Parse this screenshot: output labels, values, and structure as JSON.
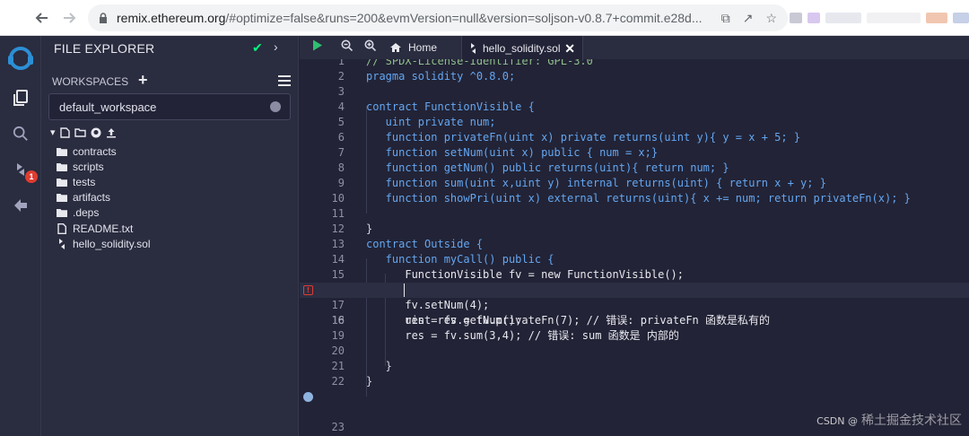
{
  "browser": {
    "url_host": "remix.ethereum.org",
    "url_path": "/#optimize=false&runs=200&evmVersion=null&version=soljson-v0.8.7+commit.e28d..."
  },
  "icon_panel": {
    "badge_count": "1"
  },
  "side_panel": {
    "title": "FILE EXPLORER",
    "workspaces_label": "WORKSPACES",
    "workspace_selected": "default_workspace",
    "files": [
      {
        "name": "contracts",
        "type": "folder"
      },
      {
        "name": "scripts",
        "type": "folder"
      },
      {
        "name": "tests",
        "type": "folder"
      },
      {
        "name": "artifacts",
        "type": "folder"
      },
      {
        "name": ".deps",
        "type": "folder"
      },
      {
        "name": "README.txt",
        "type": "file"
      },
      {
        "name": "hello_solidity.sol",
        "type": "solidity"
      }
    ]
  },
  "tabs": {
    "home_label": "Home",
    "file_label": "hello_solidity.sol"
  },
  "code": {
    "lines": [
      {
        "n": "1",
        "text": "// SPDX-License-Identifier: GPL-3.0"
      },
      {
        "n": "2",
        "text": "pragma solidity ^0.8.0;"
      },
      {
        "n": "3",
        "text": ""
      },
      {
        "n": "4",
        "text": "contract FunctionVisible {"
      },
      {
        "n": "5",
        "text": "   uint private num;"
      },
      {
        "n": "6",
        "text": "   function privateFn(uint x) private returns(uint y){ y = x + 5; }"
      },
      {
        "n": "7",
        "text": "   function setNum(uint x) public { num = x;}"
      },
      {
        "n": "8",
        "text": "   function getNum() public returns(uint){ return num; }"
      },
      {
        "n": "9",
        "text": "   function sum(uint x,uint y) internal returns(uint) { return x + y; }"
      },
      {
        "n": "10",
        "text": "   function showPri(uint x) external returns(uint){ x += num; return privateFn(x); }"
      },
      {
        "n": "11",
        "text": ""
      },
      {
        "n": "12",
        "text": "}"
      },
      {
        "n": "13",
        "text": "contract Outside {"
      },
      {
        "n": "14",
        "text": "   function myCall() public {"
      },
      {
        "n": "15",
        "text": "      FunctionVisible fv = new FunctionVisible();"
      },
      {
        "n": "16",
        "text": "      uint res = fv.privateFn(7); // 错误: privateFn 函数是私有的"
      },
      {
        "n": "17",
        "text": "      fv.setNum(4);"
      },
      {
        "n": "18",
        "text": "      res = fv.getNum();"
      },
      {
        "n": "19",
        "text": "      res = fv.sum(3,4); // 错误: sum 函数是 内部的"
      },
      {
        "n": "20",
        "text": ""
      },
      {
        "n": "21",
        "text": "   }"
      },
      {
        "n": "22",
        "text": "}"
      },
      {
        "n": "23",
        "text": ""
      }
    ]
  },
  "watermark": {
    "csdn": "CSDN @",
    "text": "稀土掘金技术社区"
  }
}
